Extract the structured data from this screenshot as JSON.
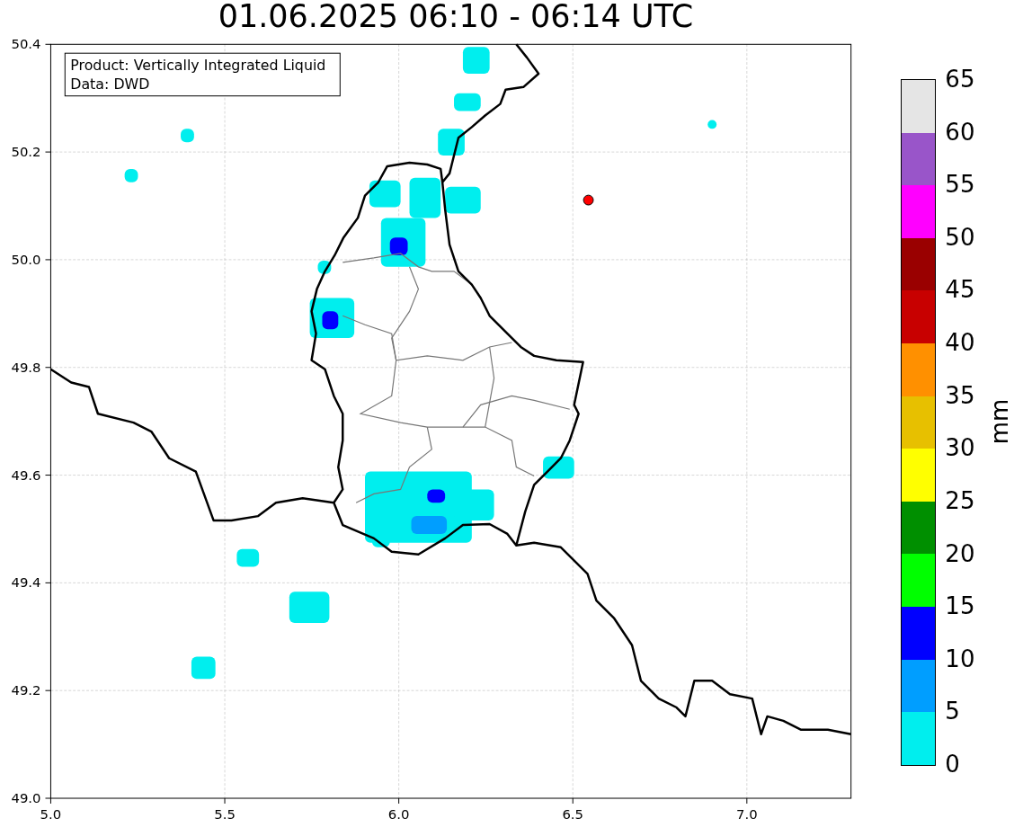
{
  "title": "01.06.2025 06:10 - 06:14 UTC",
  "map": {
    "legend": [
      "Product: Vertically Integrated Liquid",
      "Data: DWD"
    ],
    "xticks": [
      "5.0",
      "5.5",
      "6.0",
      "6.5",
      "7.0"
    ],
    "yticks": [
      "50.4",
      "50.2",
      "50.0",
      "49.8",
      "49.6",
      "49.4",
      "49.2",
      "49.0"
    ]
  },
  "colorbar": {
    "label": "mm",
    "bins": [
      {
        "color": "#e5e5e5"
      },
      {
        "color": "#9955c9"
      },
      {
        "color": "#ff00ff"
      },
      {
        "color": "#9a0000"
      },
      {
        "color": "#c80000"
      },
      {
        "color": "#ff9000"
      },
      {
        "color": "#e7c000"
      },
      {
        "color": "#ffff00"
      },
      {
        "color": "#008f00"
      },
      {
        "color": "#00ff00"
      },
      {
        "color": "#0000ff"
      },
      {
        "color": "#009eff"
      },
      {
        "color": "#00eeee"
      }
    ],
    "ticks": [
      "65",
      "60",
      "55",
      "50",
      "45",
      "40",
      "35",
      "30",
      "25",
      "20",
      "15",
      "10",
      "5",
      "0"
    ]
  }
}
